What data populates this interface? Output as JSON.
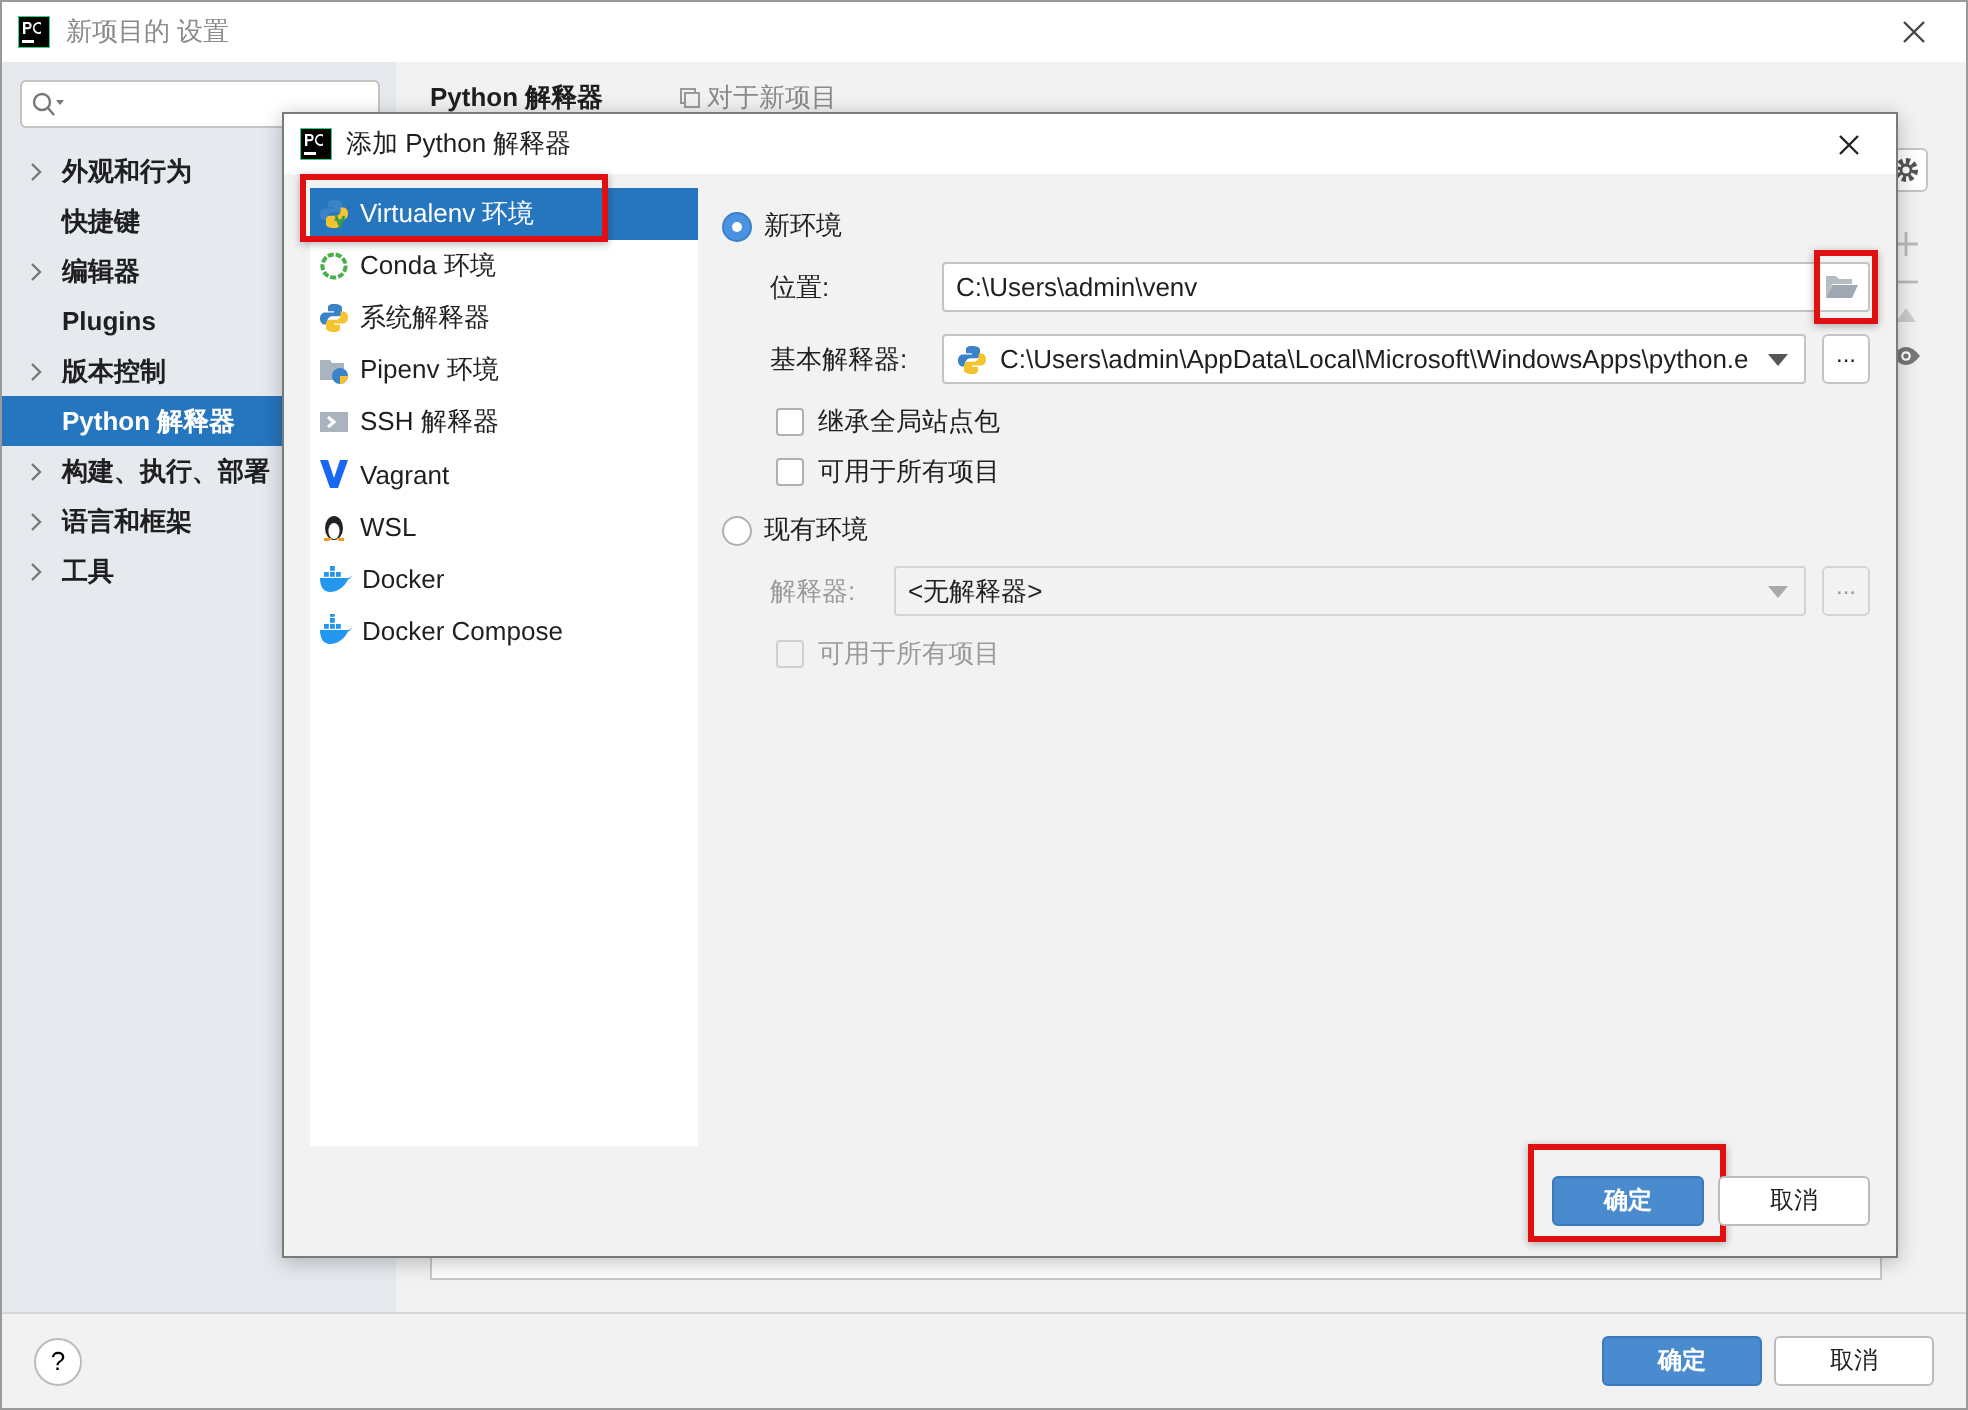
{
  "window": {
    "title": "新项目的 设置"
  },
  "sidebar": {
    "items": [
      {
        "label": "外观和行为",
        "collapsible": true,
        "selected": false
      },
      {
        "label": "快捷键",
        "collapsible": false,
        "selected": false
      },
      {
        "label": "编辑器",
        "collapsible": true,
        "selected": false
      },
      {
        "label": "Plugins",
        "collapsible": false,
        "selected": false
      },
      {
        "label": "版本控制",
        "collapsible": true,
        "selected": false
      },
      {
        "label": "Python 解释器",
        "collapsible": false,
        "selected": true
      },
      {
        "label": "构建、执行、部署",
        "collapsible": true,
        "selected": false
      },
      {
        "label": "语言和框架",
        "collapsible": true,
        "selected": false
      },
      {
        "label": "工具",
        "collapsible": true,
        "selected": false
      }
    ]
  },
  "page": {
    "title": "Python 解释器",
    "scope": "对于新项目"
  },
  "footer": {
    "help": "?",
    "buttons": [
      {
        "label": "确定",
        "kind": "primary"
      },
      {
        "label": "取消",
        "kind": "secondary"
      }
    ]
  },
  "dialog": {
    "title": "添加 Python 解释器",
    "types": [
      {
        "label": "Virtualenv 环境",
        "selected": true,
        "highlighted": true
      },
      {
        "label": "Conda 环境",
        "selected": false,
        "highlighted": false
      },
      {
        "label": "系统解释器",
        "selected": false,
        "highlighted": false
      },
      {
        "label": "Pipenv 环境",
        "selected": false,
        "highlighted": false
      },
      {
        "label": "SSH 解释器",
        "selected": false,
        "highlighted": false
      },
      {
        "label": "Vagrant",
        "selected": false,
        "highlighted": false
      },
      {
        "label": "WSL",
        "selected": false,
        "highlighted": false
      },
      {
        "label": "Docker",
        "selected": false,
        "highlighted": false
      },
      {
        "label": "Docker Compose",
        "selected": false,
        "highlighted": false
      }
    ],
    "new_environment": {
      "label": "新环境",
      "selected": true,
      "location": {
        "label": "位置:",
        "value": "C:\\Users\\admin\\venv",
        "browse_highlighted": true
      },
      "base": {
        "label": "基本解释器:",
        "value": "C:\\Users\\admin\\AppData\\Local\\Microsoft\\WindowsApps\\python.e",
        "browse": "..."
      },
      "options": [
        {
          "label": "继承全局站点包",
          "checked": false
        },
        {
          "label": "可用于所有项目",
          "checked": false
        }
      ]
    },
    "existing_environment": {
      "label": "现有环境",
      "selected": false,
      "interpreter": {
        "label": "解释器:",
        "value": "<无解释器>",
        "browse": "...",
        "disabled": true
      },
      "options": [
        {
          "label": "可用于所有项目",
          "checked": false,
          "disabled": true
        }
      ]
    },
    "buttons": [
      {
        "label": "确定",
        "kind": "primary",
        "highlighted": true
      },
      {
        "label": "取消",
        "kind": "secondary",
        "highlighted": false
      }
    ]
  }
}
